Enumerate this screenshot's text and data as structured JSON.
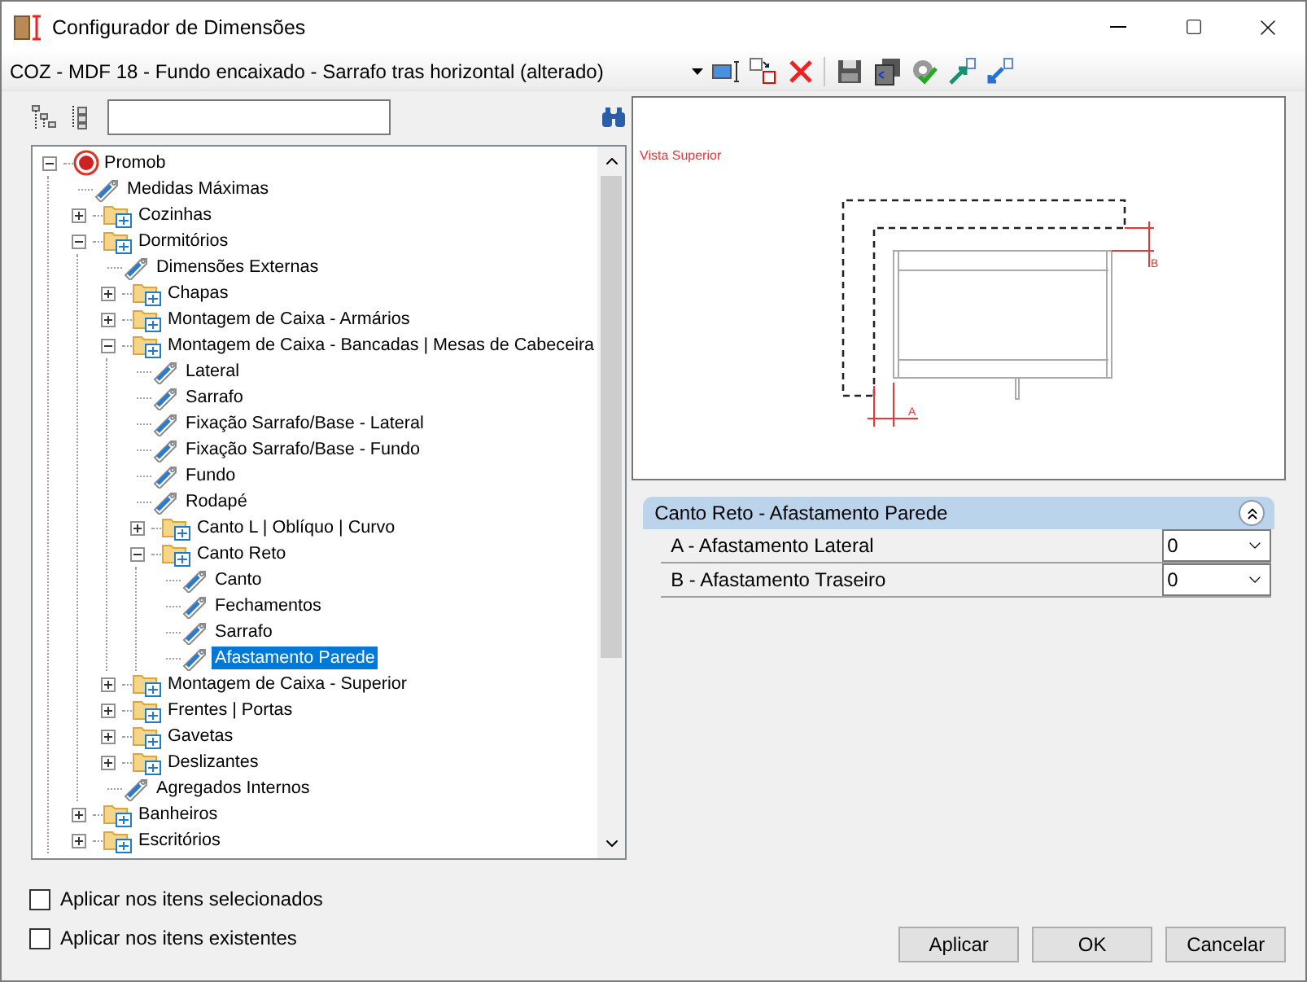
{
  "window": {
    "title": "Configurador de Dimensões"
  },
  "configuration": {
    "value": "COZ - MDF 18 - Fundo encaixado - Sarrafo tras horizontal (alterado)"
  },
  "tree": [
    {
      "label": "Promob",
      "kind": "root",
      "expanded": true,
      "selected": false,
      "children": [
        {
          "label": "Medidas Máximas",
          "kind": "item",
          "selected": false
        },
        {
          "label": "Cozinhas",
          "kind": "folder",
          "expanded": false,
          "selected": false
        },
        {
          "label": "Dormitórios",
          "kind": "folder",
          "expanded": true,
          "selected": false,
          "children": [
            {
              "label": "Dimensões Externas",
              "kind": "item",
              "selected": false
            },
            {
              "label": "Chapas",
              "kind": "folder",
              "expanded": false,
              "selected": false
            },
            {
              "label": "Montagem de Caixa - Armários",
              "kind": "folder",
              "expanded": false,
              "selected": false
            },
            {
              "label": "Montagem de Caixa - Bancadas | Mesas de Cabeceira",
              "kind": "folder",
              "expanded": true,
              "selected": false,
              "children": [
                {
                  "label": "Lateral",
                  "kind": "item",
                  "selected": false
                },
                {
                  "label": "Sarrafo",
                  "kind": "item",
                  "selected": false
                },
                {
                  "label": "Fixação Sarrafo/Base - Lateral",
                  "kind": "item",
                  "selected": false
                },
                {
                  "label": "Fixação Sarrafo/Base - Fundo",
                  "kind": "item",
                  "selected": false
                },
                {
                  "label": "Fundo",
                  "kind": "item",
                  "selected": false
                },
                {
                  "label": "Rodapé",
                  "kind": "item",
                  "selected": false
                },
                {
                  "label": "Canto L | Oblíquo | Curvo",
                  "kind": "folder",
                  "expanded": false,
                  "selected": false
                },
                {
                  "label": "Canto Reto",
                  "kind": "folder",
                  "expanded": true,
                  "selected": false,
                  "children": [
                    {
                      "label": "Canto",
                      "kind": "item",
                      "selected": false
                    },
                    {
                      "label": "Fechamentos",
                      "kind": "item",
                      "selected": false
                    },
                    {
                      "label": "Sarrafo",
                      "kind": "item",
                      "selected": false
                    },
                    {
                      "label": "Afastamento Parede",
                      "kind": "item",
                      "selected": true
                    }
                  ]
                }
              ]
            },
            {
              "label": "Montagem de Caixa - Superior",
              "kind": "folder",
              "expanded": false,
              "selected": false
            },
            {
              "label": "Frentes | Portas",
              "kind": "folder",
              "expanded": false,
              "selected": false
            },
            {
              "label": "Gavetas",
              "kind": "folder",
              "expanded": false,
              "selected": false
            },
            {
              "label": "Deslizantes",
              "kind": "folder",
              "expanded": false,
              "selected": false
            },
            {
              "label": "Agregados Internos",
              "kind": "item",
              "selected": false
            }
          ]
        },
        {
          "label": "Banheiros",
          "kind": "folder",
          "expanded": false,
          "selected": false
        },
        {
          "label": "Escritórios",
          "kind": "folder",
          "expanded": false,
          "selected": false
        }
      ]
    }
  ],
  "options": [
    {
      "label": "Aplicar nos itens selecionados",
      "checked": false
    },
    {
      "label": "Aplicar nos itens existentes",
      "checked": false
    }
  ],
  "preview": {
    "title": "Vista Superior",
    "marks": [
      "A",
      "B"
    ]
  },
  "properties": {
    "group": "Canto Reto - Afastamento Parede",
    "expanded": true,
    "rows": [
      {
        "label": "A - Afastamento Lateral",
        "value": "0"
      },
      {
        "label": "B - Afastamento Traseiro",
        "value": "0"
      }
    ]
  },
  "buttons": [
    "Aplicar",
    "OK",
    "Cancelar"
  ]
}
